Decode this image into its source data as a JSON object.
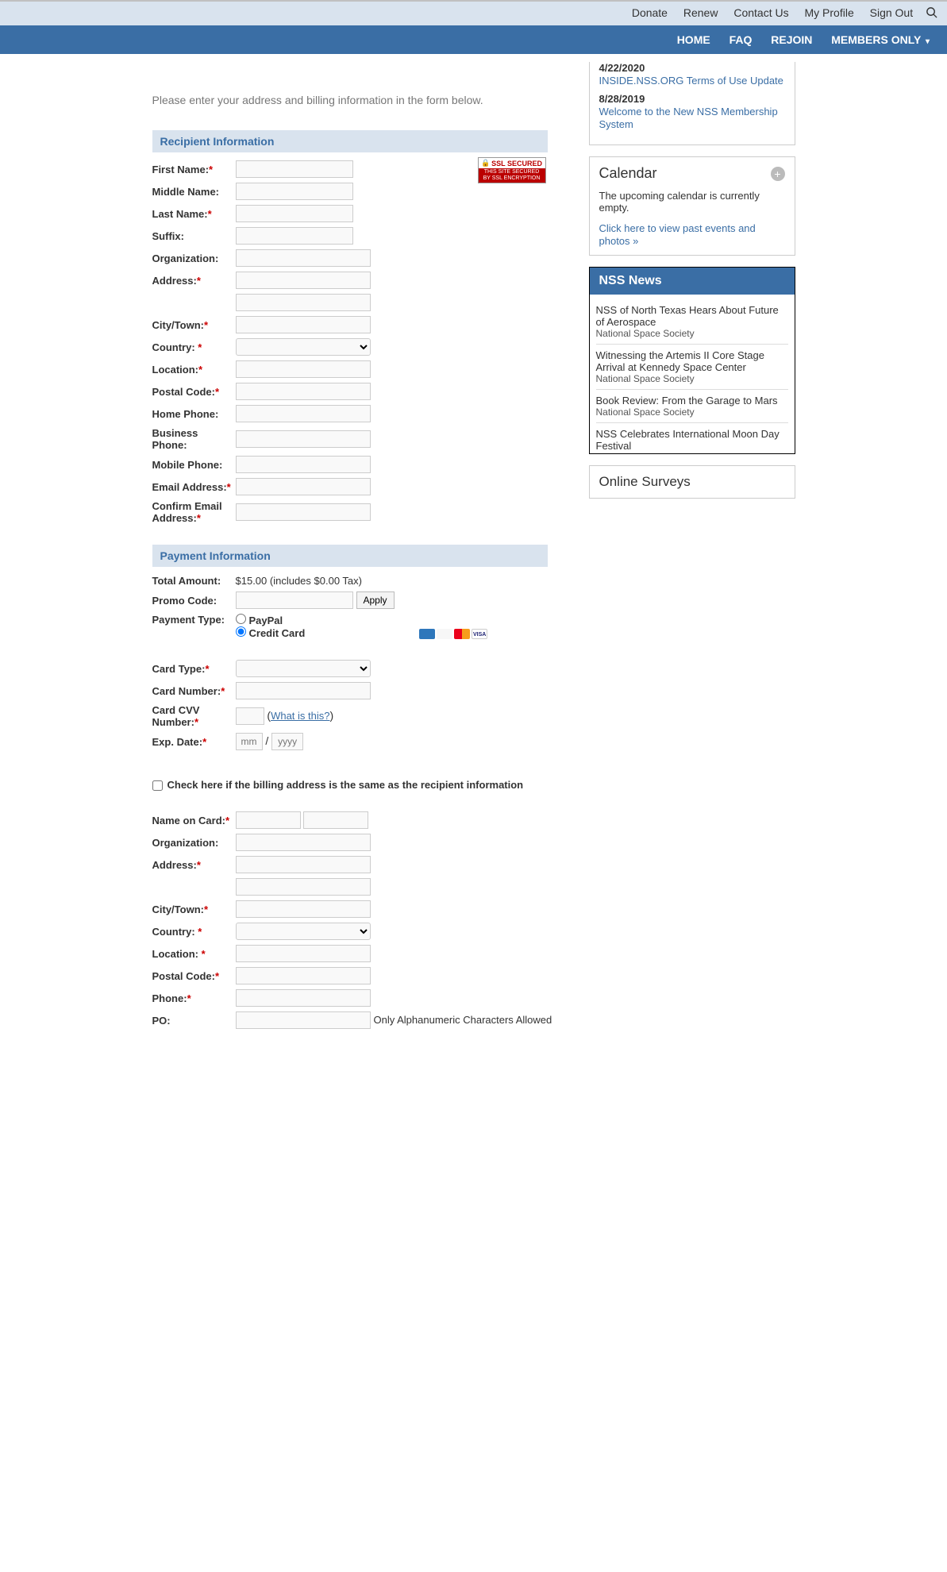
{
  "topbar": {
    "donate": "Donate",
    "renew": "Renew",
    "contact": "Contact Us",
    "profile": "My Profile",
    "signout": "Sign Out"
  },
  "navbar": {
    "home": "HOME",
    "faq": "FAQ",
    "rejoin": "REJOIN",
    "members": "MEMBERS ONLY"
  },
  "intro": "Please enter your address and billing information in the form below.",
  "sections": {
    "recipient": "Recipient Information",
    "payment": "Payment Information"
  },
  "labels": {
    "first_name": "First Name:",
    "middle_name": "Middle Name:",
    "last_name": "Last Name:",
    "suffix": "Suffix:",
    "organization": "Organization:",
    "address": "Address:",
    "city": "City/Town:",
    "country": "Country:",
    "location": "Location:",
    "postal": "Postal Code:",
    "home_phone": "Home Phone:",
    "bus_phone": "Business Phone:",
    "mobile": "Mobile Phone:",
    "email": "Email Address:",
    "confirm_email": "Confirm Email Address:",
    "total_amount": "Total Amount:",
    "promo": "Promo Code:",
    "pay_type": "Payment Type:",
    "card_type": "Card Type:",
    "card_number": "Card Number:",
    "cvv": "Card CVV Number:",
    "exp": "Exp. Date:",
    "name_card": "Name on Card:",
    "phone": "Phone:",
    "po": "PO:"
  },
  "ssl": {
    "top": "SSL SECURED",
    "line1": "THIS SITE SECURED",
    "line2": "BY SSL ENCRYPTION"
  },
  "payment": {
    "total": "$15.00 (includes $0.00 Tax)",
    "apply": "Apply",
    "paypal": "PayPal",
    "cc": "Credit Card",
    "whatisthis": "What is this?",
    "mm_ph": "mm",
    "yy_ph": "yyyy",
    "same_addr": "Check here if the billing address is the same as the recipient information",
    "po_note": "Only Alphanumeric Characters Allowed"
  },
  "sidebar": {
    "notices": [
      {
        "date": "4/22/2020",
        "title": "INSIDE.NSS.ORG Terms of Use Update"
      },
      {
        "date": "8/28/2019",
        "title": "Welcome to the New NSS Membership System"
      }
    ],
    "calendar": {
      "title": "Calendar",
      "empty": "The upcoming calendar is currently empty.",
      "past": "Click here to view past events and photos »"
    },
    "news_head": "NSS News",
    "news": [
      {
        "title": "NSS of North Texas Hears About Future of Aerospace",
        "src": "National Space Society"
      },
      {
        "title": "Witnessing the Artemis II Core Stage Arrival at Kennedy Space Center",
        "src": "National Space Society"
      },
      {
        "title": "Book Review: From the Garage to Mars",
        "src": "National Space Society"
      },
      {
        "title": "NSS Celebrates International Moon Day Festival",
        "src": "National Space Society"
      }
    ],
    "surveys": "Online Surveys"
  }
}
